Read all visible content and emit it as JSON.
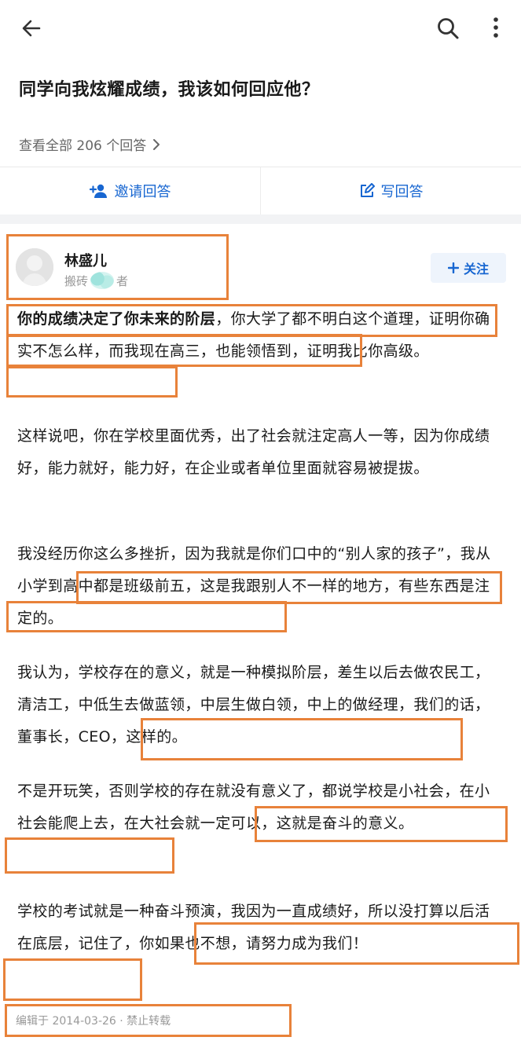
{
  "header": {
    "back_icon": "arrow-left-icon",
    "search_icon": "search-icon",
    "more_icon": "more-vertical-icon"
  },
  "question": {
    "title": "同学向我炫耀成绩，我该如何回应他？",
    "view_all": "查看全部 206 个回答",
    "invite_label": "邀请回答",
    "write_label": "写回答"
  },
  "author": {
    "name": "林盛儿",
    "sub_prefix": "搬砖",
    "sub_suffix": "者",
    "follow_label": "关注"
  },
  "answer": {
    "p1_bold": "你的成绩决定了你未来的阶层",
    "p1_rest": "，你大学了都不明白这个道理，证明你确实不怎么样，而我现在高三，也能领悟到，证明我比你高级。",
    "p2": "这样说吧，你在学校里面优秀，出了社会就注定高人一等，因为你成绩好，能力就好，能力好，在企业或者单位里面就容易被提拔。",
    "p3": "我没经历你这么多挫折，因为我就是你们口中的“别人家的孩子”，我从小学到高中都是班级前五，这是我跟别人不一样的地方，有些东西是注定的。",
    "p4": "我认为，学校存在的意义，就是一种模拟阶层，差生以后去做农民工，清洁工，中低生去做蓝领，中层生做白领，中上的做经理，我们的话，董事长，CEO，这样的。",
    "p5": "不是开玩笑，否则学校的存在就没有意义了，都说学校是小社会，在小社会能爬上去，在大社会就一定可以，这就是奋斗的意义。",
    "p6": "学校的考试就是一种奋斗预演，我因为一直成绩好，所以没打算以后活在底层，记住了，你如果也不想，请努力成为我们！"
  },
  "footer": {
    "edited": "编辑于 2014-03-26 · 禁止转载"
  },
  "colors": {
    "accent": "#1766d1",
    "highlight_box": "#e8823a"
  }
}
